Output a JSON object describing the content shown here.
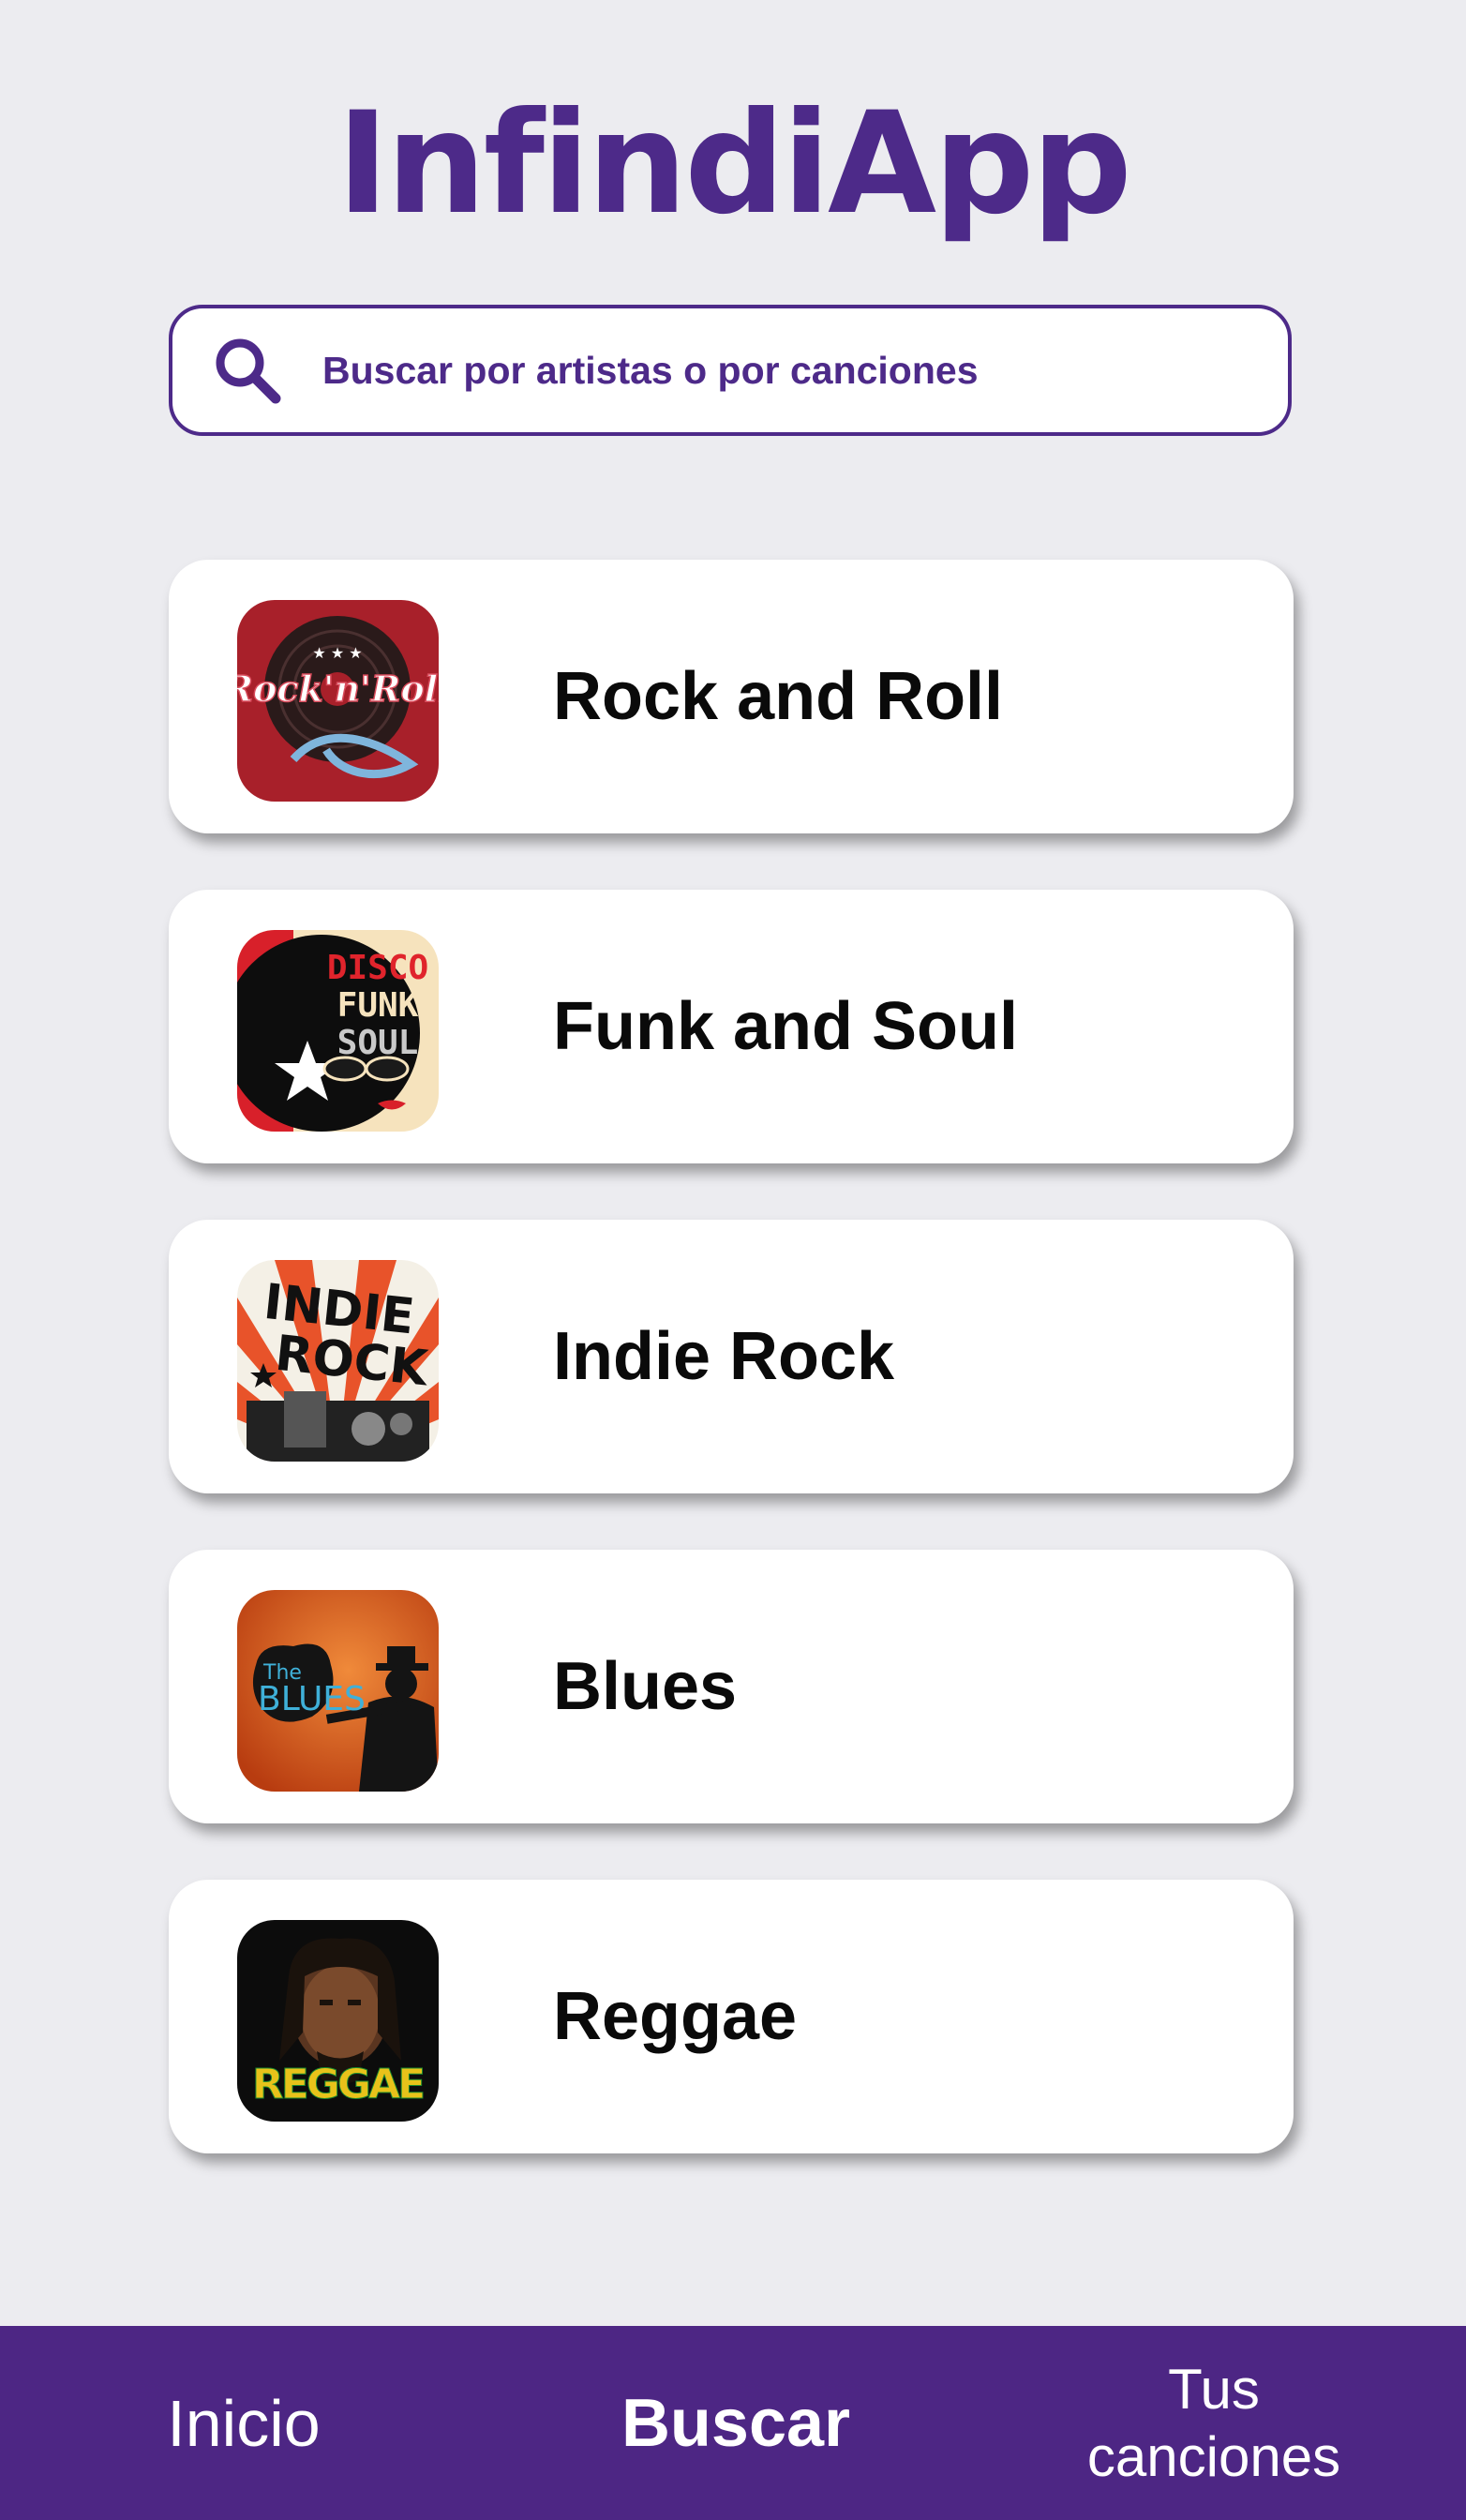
{
  "header": {
    "title": "InfindiApp"
  },
  "search": {
    "placeholder": "Buscar por artistas o por canciones",
    "icon": "search-icon"
  },
  "genres": [
    {
      "label": "Rock and Roll",
      "thumb_text": "Rock'n'Roll"
    },
    {
      "label": "Funk and Soul",
      "thumb_text_1": "DISCO",
      "thumb_text_2": "FUNK",
      "thumb_text_3": "SOUL"
    },
    {
      "label": "Indie Rock",
      "thumb_text_1": "INDIE",
      "thumb_text_2": "ROCK"
    },
    {
      "label": "Blues",
      "thumb_text_1": "The",
      "thumb_text_2": "BLUES"
    },
    {
      "label": "Reggae",
      "thumb_text": "REGGAE"
    }
  ],
  "nav": {
    "inicio": "Inicio",
    "buscar": "Buscar",
    "tus_canciones": "Tus\ncanciones"
  },
  "colors": {
    "accent": "#4d2a89",
    "nav_bg": "#4d2684",
    "background": "#ececf0"
  }
}
